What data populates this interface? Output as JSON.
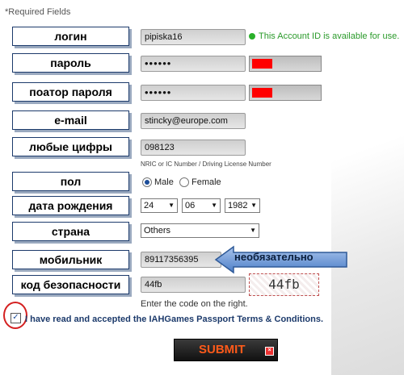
{
  "required_note": "*Required Fields",
  "labels": {
    "login": "логин",
    "password": "пароль",
    "password_repeat": "поатор пароля",
    "email": "e-mail",
    "numbers": "любые цифры",
    "gender": "пол",
    "birthdate": "дата рождения",
    "country": "страна",
    "mobile": "мобильник",
    "security_code": "код безопасности"
  },
  "fields": {
    "login_value": "pipiska16",
    "login_status": "This Account ID is available for use.",
    "password_value": "••••••",
    "password_repeat_value": "••••••",
    "email_value": "stincky@europe.com",
    "numbers_value": "098123",
    "numbers_hint": "NRIC or IC Number / Driving License Number",
    "mobile_value": "89117356395",
    "mobile_note": "необязательно",
    "security_code_value": "44fb",
    "captcha_text": "44fb",
    "code_hint": "Enter the code on the right."
  },
  "gender": {
    "male": "Male",
    "female": "Female",
    "selected": "male"
  },
  "birthdate": {
    "day": "24",
    "month": "06",
    "year": "1982"
  },
  "country": {
    "selected": "Others"
  },
  "password_strength": 0.3,
  "terms": {
    "checked": true,
    "text": "I have read and accepted the IAHGames Passport Terms & Conditions."
  },
  "submit_label": "SUBMIT",
  "colors": {
    "label_border": "#1c3a6b",
    "status_green": "#2a9a2a",
    "strength_red": "#ff0000",
    "submit_text": "#ff5a1a"
  }
}
